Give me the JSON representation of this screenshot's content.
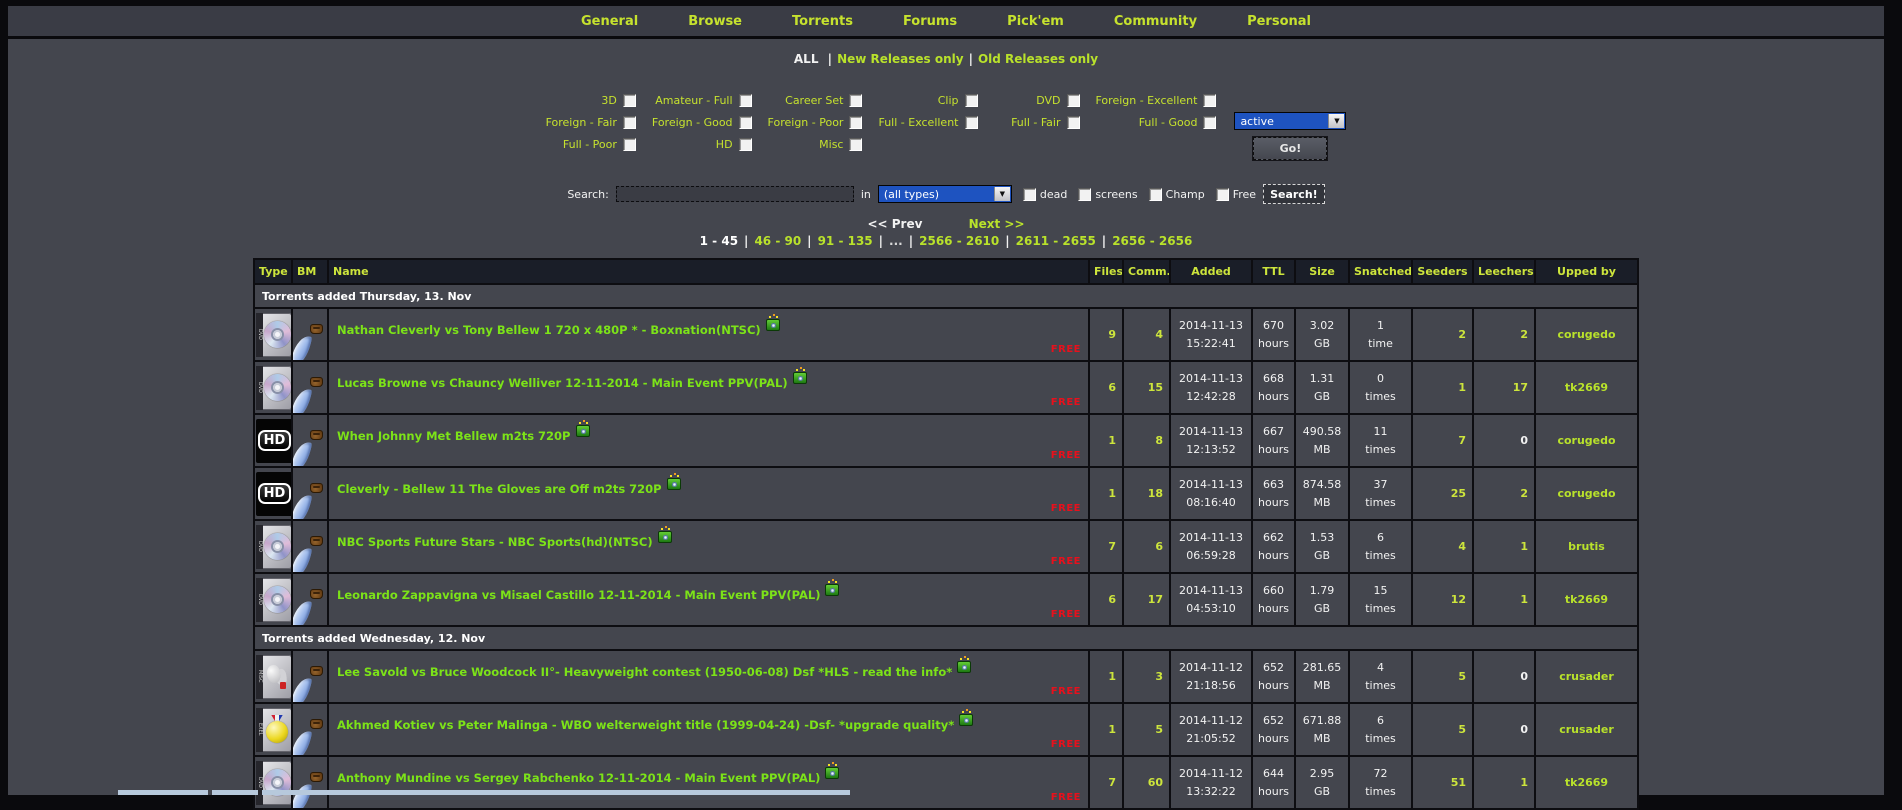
{
  "colors": {
    "accent_yellow_green": "#c6e22e",
    "name_green": "#7ce318",
    "free_red": "#e8101c",
    "select_blue": "#1e53c0",
    "header_bg": "#1a1e28",
    "page_bg": "#44464e"
  },
  "nav": {
    "items": [
      "General",
      "Browse",
      "Torrents",
      "Forums",
      "Pick'em",
      "Community",
      "Personal"
    ]
  },
  "release_filter": {
    "current": "ALL",
    "separator": "|",
    "links": [
      "New Releases only",
      "Old Releases only"
    ]
  },
  "categories": {
    "rows": [
      [
        "3D",
        "Amateur - Full",
        "Career Set",
        "Clip",
        "DVD",
        "Foreign - Excellent"
      ],
      [
        "Foreign - Fair",
        "Foreign - Good",
        "Foreign - Poor",
        "Full - Excellent",
        "Full - Fair",
        "Full - Good"
      ],
      [
        "Full - Poor",
        "HD",
        "Misc"
      ]
    ],
    "status_select_value": "active",
    "go_label": "Go!"
  },
  "search": {
    "label": "Search:",
    "input_value": "",
    "in_label": "in",
    "type_select_value": "(all types)",
    "checkboxes": [
      "dead",
      "screens",
      "Champ",
      "Free"
    ],
    "button_label": "Search!"
  },
  "pagination": {
    "prev": "<< Prev",
    "next": "Next >>",
    "separator": "|",
    "pages": [
      {
        "label": "1 - 45",
        "current": true
      },
      {
        "label": "46 - 90"
      },
      {
        "label": "91 - 135"
      },
      {
        "label": "...",
        "plain": true
      },
      {
        "label": "2566 - 2610"
      },
      {
        "label": "2611 - 2655"
      },
      {
        "label": "2656 - 2656"
      }
    ]
  },
  "icons": {
    "bm": "feather-quill-with-pouch",
    "after_name": "screenshot-camera",
    "hd_label": "HD",
    "dvd_spine": "DVD",
    "misc_spine": "MISC",
    "exel_spine": "EXEL"
  },
  "table": {
    "headers": [
      "Type",
      "BM",
      "Name",
      "Files",
      "Comm.",
      "Added",
      "TTL",
      "Size",
      "Snatched",
      "Seeders",
      "Leechers",
      "Upped by"
    ],
    "free_label": "FREE",
    "rows": [
      {
        "section": "Torrents added Thursday, 13. Nov"
      },
      {
        "type_icon": "dvd",
        "name": "Nathan Cleverly vs Tony Bellew 1 720 x 480P * - Boxnation(NTSC)",
        "free": true,
        "files": "9",
        "comm": "4",
        "added": [
          "2014-11-13",
          "15:22:41"
        ],
        "ttl": [
          "670",
          "hours"
        ],
        "size": [
          "3.02",
          "GB"
        ],
        "snatched": [
          "1",
          "time"
        ],
        "seeders": "2",
        "leechers": "2",
        "upped_by": "corugedo"
      },
      {
        "type_icon": "dvd",
        "name": "Lucas Browne vs Chauncy Welliver 12-11-2014 - Main Event PPV(PAL)",
        "free": true,
        "files": "6",
        "comm": "15",
        "added": [
          "2014-11-13",
          "12:42:28"
        ],
        "ttl": [
          "668",
          "hours"
        ],
        "size": [
          "1.31",
          "GB"
        ],
        "snatched": [
          "0",
          "times"
        ],
        "seeders": "1",
        "leechers": "17",
        "upped_by": "tk2669"
      },
      {
        "type_icon": "hd",
        "name": "When Johnny Met Bellew m2ts 720P",
        "free": true,
        "files": "1",
        "comm": "8",
        "added": [
          "2014-11-13",
          "12:13:52"
        ],
        "ttl": [
          "667",
          "hours"
        ],
        "size": [
          "490.58",
          "MB"
        ],
        "snatched": [
          "11",
          "times"
        ],
        "seeders": "7",
        "leechers": "0",
        "upped_by": "corugedo"
      },
      {
        "type_icon": "hd",
        "name": "Cleverly - Bellew 11 The Gloves are Off m2ts 720P",
        "free": true,
        "files": "1",
        "comm": "18",
        "added": [
          "2014-11-13",
          "08:16:40"
        ],
        "ttl": [
          "663",
          "hours"
        ],
        "size": [
          "874.58",
          "MB"
        ],
        "snatched": [
          "37",
          "times"
        ],
        "seeders": "25",
        "leechers": "2",
        "upped_by": "corugedo"
      },
      {
        "type_icon": "dvd",
        "name": "NBC Sports Future Stars - NBC Sports(hd)(NTSC)",
        "free": true,
        "files": "7",
        "comm": "6",
        "added": [
          "2014-11-13",
          "06:59:28"
        ],
        "ttl": [
          "662",
          "hours"
        ],
        "size": [
          "1.53",
          "GB"
        ],
        "snatched": [
          "6",
          "times"
        ],
        "seeders": "4",
        "leechers": "1",
        "upped_by": "brutis"
      },
      {
        "type_icon": "dvd",
        "name": "Leonardo Zappavigna vs Misael Castillo 12-11-2014 - Main Event PPV(PAL)",
        "free": true,
        "files": "6",
        "comm": "17",
        "added": [
          "2014-11-13",
          "04:53:10"
        ],
        "ttl": [
          "660",
          "hours"
        ],
        "size": [
          "1.79",
          "GB"
        ],
        "snatched": [
          "15",
          "times"
        ],
        "seeders": "12",
        "leechers": "1",
        "upped_by": "tk2669"
      },
      {
        "section": "Torrents added Wednesday, 12. Nov"
      },
      {
        "type_icon": "misc",
        "name": "Lee Savold vs Bruce Woodcock II°- Heavyweight contest (1950-06-08) Dsf *HLS - read the info*",
        "free": true,
        "files": "1",
        "comm": "3",
        "added": [
          "2014-11-12",
          "21:18:56"
        ],
        "ttl": [
          "652",
          "hours"
        ],
        "size": [
          "281.65",
          "MB"
        ],
        "snatched": [
          "4",
          "times"
        ],
        "seeders": "5",
        "leechers": "0",
        "upped_by": "crusader"
      },
      {
        "type_icon": "exel",
        "name": "Akhmed Kotiev vs Peter Malinga - WBO welterweight title (1999-04-24) -Dsf- *upgrade quality*",
        "free": true,
        "files": "1",
        "comm": "5",
        "added": [
          "2014-11-12",
          "21:05:52"
        ],
        "ttl": [
          "652",
          "hours"
        ],
        "size": [
          "671.88",
          "MB"
        ],
        "snatched": [
          "6",
          "times"
        ],
        "seeders": "5",
        "leechers": "0",
        "upped_by": "crusader"
      },
      {
        "type_icon": "dvd",
        "name": "Anthony Mundine vs Sergey Rabchenko 12-11-2014 - Main Event PPV(PAL)",
        "free": true,
        "files": "7",
        "comm": "60",
        "added": [
          "2014-11-12",
          "13:32:22"
        ],
        "ttl": [
          "644",
          "hours"
        ],
        "size": [
          "2.95",
          "GB"
        ],
        "snatched": [
          "72",
          "times"
        ],
        "seeders": "51",
        "leechers": "1",
        "upped_by": "tk2669"
      }
    ]
  }
}
